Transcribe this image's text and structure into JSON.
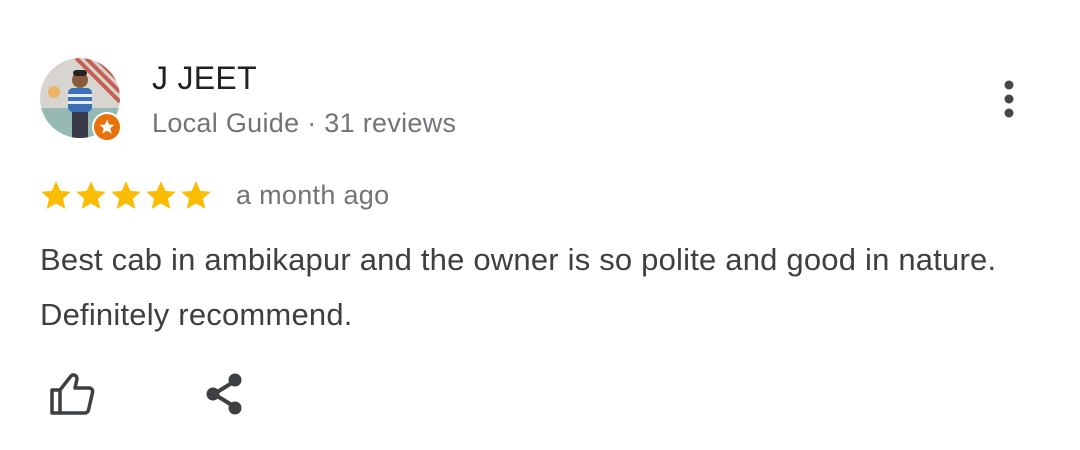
{
  "review": {
    "reviewer": {
      "name": "J JEET",
      "meta": "Local Guide · 31 reviews",
      "avatar_icon": "user-photo",
      "badge_icon": "local-guide-star-icon",
      "badge_color": "#e8710a"
    },
    "rating": {
      "stars": 5,
      "max": 5,
      "star_color": "#fbbc04"
    },
    "date": "a month ago",
    "text": "Best cab in ambikapur and the owner is so polite and good in nature. Definitely recommend.",
    "actions": {
      "like_icon": "thumb-up-icon",
      "share_icon": "share-icon",
      "more_icon": "more-vert-icon"
    }
  }
}
